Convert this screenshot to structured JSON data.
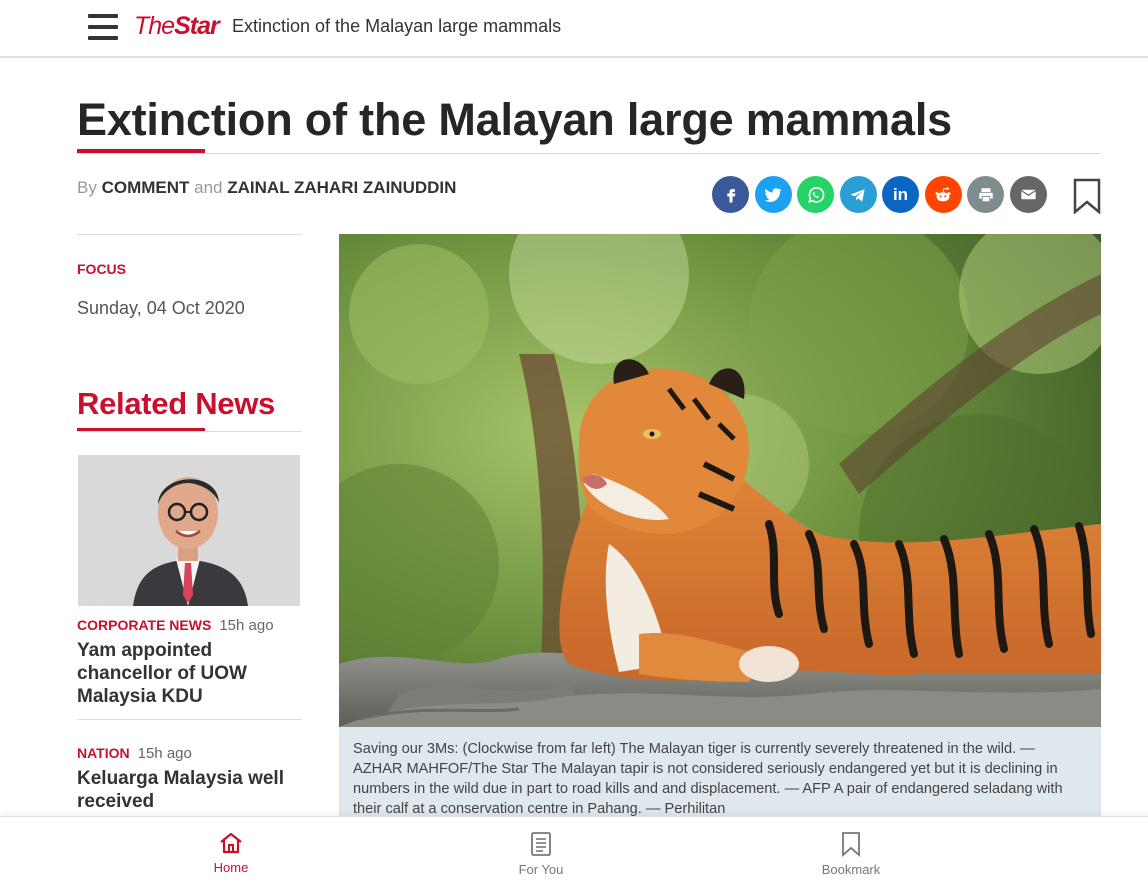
{
  "header": {
    "logo_the": "The",
    "logo_star": "Star",
    "title": "Extinction of the Malayan large mammals"
  },
  "article": {
    "headline": "Extinction of the Malayan large mammals",
    "byline_by": "By",
    "author1": "COMMENT",
    "byline_and": "and",
    "author2": "ZAINAL ZAHARI ZAINUDDIN",
    "section": "FOCUS",
    "date": "Sunday, 04 Oct 2020",
    "caption": "Saving our 3Ms: (Clockwise from far left) The Malayan tiger is currently severely threatened in the wild. — AZHAR MAHFOF/The Star The Malayan tapir is not considered seriously endangered yet but it is declining in numbers in the wild due in part to road kills and and displacement. — AFP A pair of endangered seladang with their calf at a conservation centre in Pahang. — Perhilitan"
  },
  "share": {
    "buttons": [
      {
        "name": "facebook-share-icon",
        "glyph": "f",
        "color": "#3b5998"
      },
      {
        "name": "twitter-share-icon",
        "glyph": "t",
        "color": "#1da1f2"
      },
      {
        "name": "whatsapp-share-icon",
        "glyph": "w",
        "color": "#25d366"
      },
      {
        "name": "telegram-share-icon",
        "glyph": "➤",
        "color": "#2a9fd6"
      },
      {
        "name": "linkedin-share-icon",
        "glyph": "in",
        "color": "#0a66c2"
      },
      {
        "name": "reddit-share-icon",
        "glyph": "r",
        "color": "#ff4500"
      },
      {
        "name": "print-icon",
        "glyph": "⎙",
        "color": "#7f8c8d"
      },
      {
        "name": "email-icon",
        "glyph": "✉",
        "color": "#666666"
      }
    ]
  },
  "related": {
    "title": "Related News",
    "items": [
      {
        "category": "CORPORATE NEWS",
        "time": "15h ago",
        "title": "Yam appointed chancellor of UOW Malaysia KDU"
      },
      {
        "category": "NATION",
        "time": "15h ago",
        "title": "Keluarga Malaysia well received"
      }
    ]
  },
  "bottom_nav": {
    "home": "Home",
    "for_you": "For You",
    "bookmark": "Bookmark"
  },
  "colors": {
    "brand_red": "#c8102e",
    "caption_bg": "#dfe7ef"
  }
}
